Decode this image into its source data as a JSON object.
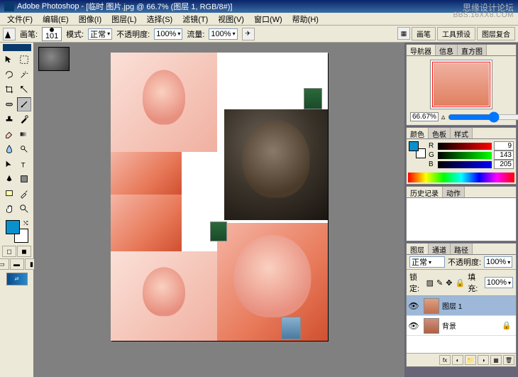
{
  "titlebar": {
    "app": "Adobe Photoshop",
    "doc": "[临时 图片.jpg @ 66.7% (图层 1, RGB/8#)]"
  },
  "menus": [
    "文件(F)",
    "编辑(E)",
    "图像(I)",
    "图层(L)",
    "选择(S)",
    "滤镜(T)",
    "视图(V)",
    "窗口(W)",
    "帮助(H)"
  ],
  "options": {
    "brush_label": "画笔:",
    "brush_size": "101",
    "mode_label": "模式:",
    "mode_value": "正常",
    "opacity_label": "不透明度:",
    "opacity_value": "100%",
    "flow_label": "流量:",
    "flow_value": "100%",
    "right_tabs": [
      "画笔",
      "工具预设",
      "图层复合"
    ]
  },
  "tools": [
    "move",
    "marquee",
    "lasso",
    "wand",
    "crop",
    "slice",
    "healing",
    "brush",
    "stamp",
    "history",
    "eraser",
    "gradient",
    "blur",
    "dodge",
    "pen",
    "type",
    "path",
    "shape",
    "notes",
    "eyedrop",
    "hand",
    "zoom"
  ],
  "active_tool": "brush",
  "swatch": {
    "fg": "#0990cd",
    "bg": "#ffffff"
  },
  "navigator": {
    "tabs": [
      "导航器",
      "信息",
      "直方图"
    ],
    "zoom": "66.67%"
  },
  "color": {
    "tabs": [
      "颜色",
      "色板",
      "样式"
    ],
    "r": 9,
    "g": 143,
    "b": 205
  },
  "history": {
    "tabs": [
      "历史记录",
      "动作"
    ]
  },
  "layers": {
    "tabs": [
      "图层",
      "通道",
      "路径"
    ],
    "blend_label": "正常",
    "opacity_label": "不透明度:",
    "opacity_value": "100%",
    "lock_label": "锁定:",
    "fill_label": "填充:",
    "fill_value": "100%",
    "items": [
      {
        "name": "图层 1",
        "visible": true
      },
      {
        "name": "背景",
        "visible": true
      }
    ]
  },
  "watermark1": "思缘设计论坛",
  "watermark2": "BBS.16XX8.COM"
}
